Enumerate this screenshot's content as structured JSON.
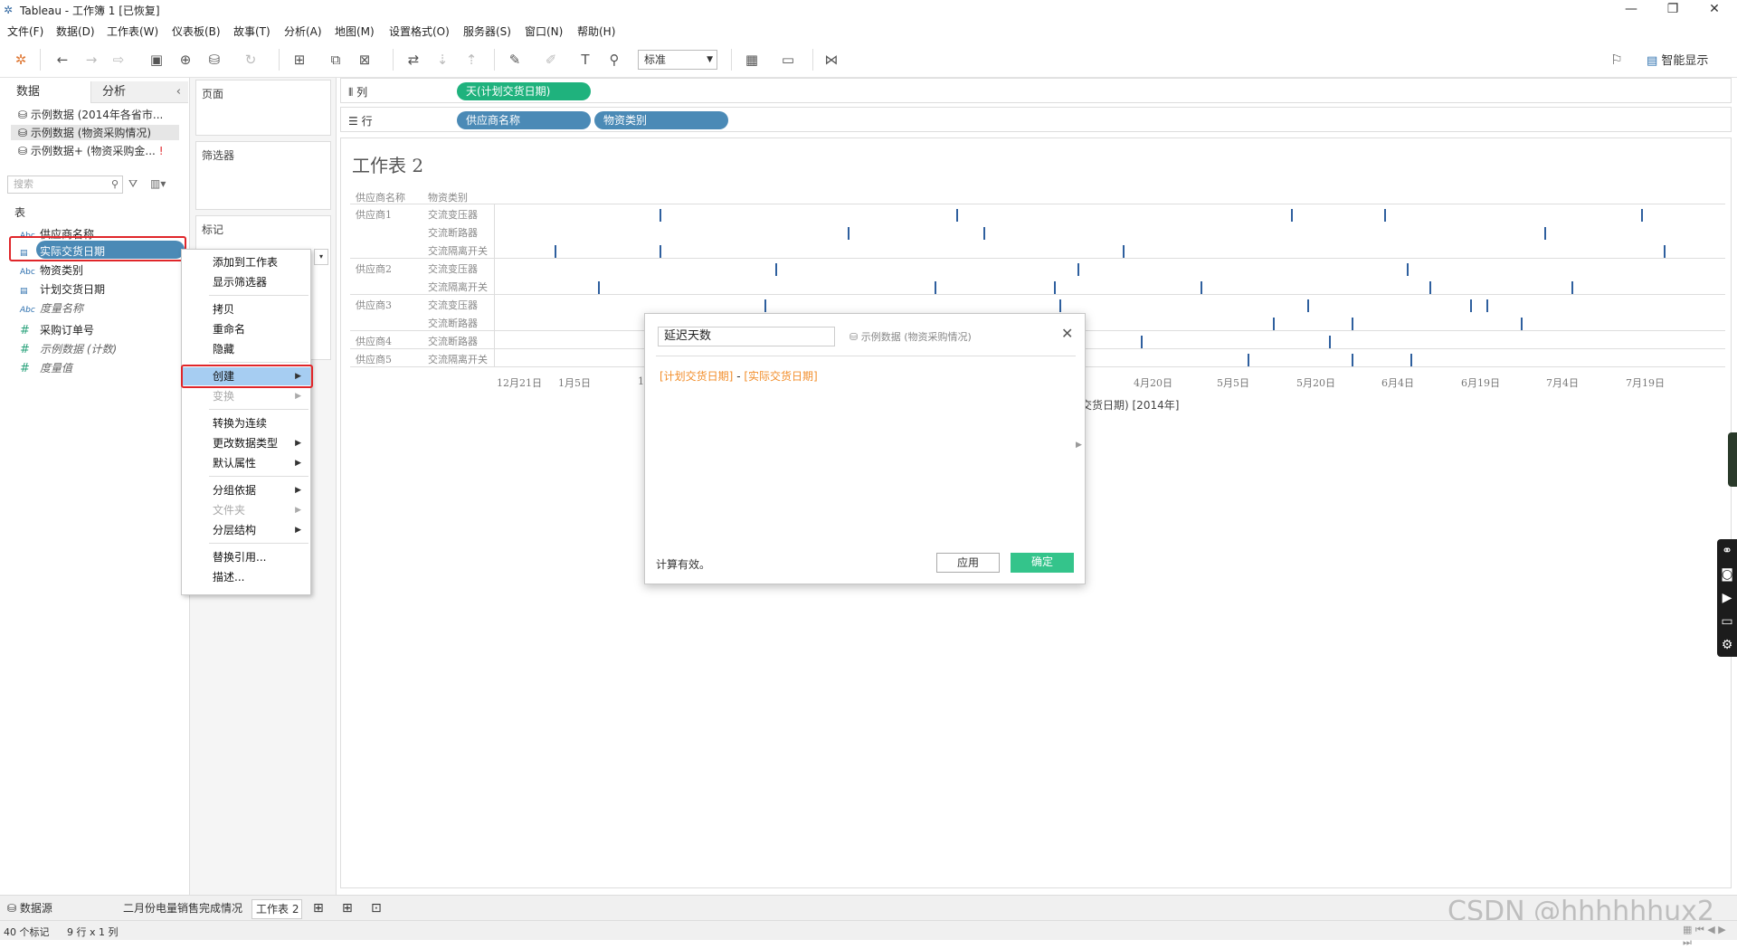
{
  "window": {
    "title": "Tableau - 工作簿 1 [已恢复]"
  },
  "menu": [
    "文件(F)",
    "数据(D)",
    "工作表(W)",
    "仪表板(B)",
    "故事(T)",
    "分析(A)",
    "地图(M)",
    "设置格式(O)",
    "服务器(S)",
    "窗口(N)",
    "帮助(H)"
  ],
  "toolbar": {
    "fit_select": "标准",
    "smart_show": "智能显示"
  },
  "left_pane": {
    "tab_data": "数据",
    "tab_analysis": "分析",
    "datasources": [
      "示例数据 (2014年各省市...",
      "示例数据 (物资采购情况)",
      "示例数据+ (物资采购金..."
    ],
    "search_placeholder": "搜索",
    "section_table": "表",
    "dimensions": [
      "供应商名称",
      "实际交货日期",
      "物资类别",
      "计划交货日期",
      "度量名称"
    ],
    "measures": [
      "采购订单号",
      "示例数据 (计数)",
      "度量值"
    ]
  },
  "cards": {
    "pages": "页面",
    "filters": "筛选器",
    "marks": "标记"
  },
  "shelves": {
    "columns_label": "列",
    "rows_label": "行",
    "columns_pills": [
      "天(计划交货日期)"
    ],
    "rows_pills": [
      "供应商名称",
      "物资类别"
    ]
  },
  "viz": {
    "title": "工作表 2",
    "header_supplier": "供应商名称",
    "header_category": "物资类别",
    "suppliers": [
      "供应商1",
      "供应商2",
      "供应商3",
      "供应商4",
      "供应商5"
    ],
    "categories": [
      "交流变压器",
      "交流断路器",
      "交流隔离开关",
      "交流变压器",
      "交流隔离开关",
      "交流变压器",
      "交流断路器",
      "交流断路器",
      "交流隔离开关"
    ],
    "axis_ticks": [
      "12月21日",
      "1月5日",
      "1",
      "4月20日",
      "5月5日",
      "5月20日",
      "6月4日",
      "6月19日",
      "7月4日",
      "7月19日"
    ],
    "axis_title": "交货日期) [2014年]"
  },
  "context_menu": {
    "items": [
      "添加到工作表",
      "显示筛选器",
      "拷贝",
      "重命名",
      "隐藏",
      "创建",
      "变换",
      "转换为连续",
      "更改数据类型",
      "默认属性",
      "分组依据",
      "文件夹",
      "分层结构",
      "替换引用...",
      "描述..."
    ]
  },
  "calc_dialog": {
    "name": "延迟天数",
    "datasource": "示例数据 (物资采购情况)",
    "formula_a": "[计划交货日期]",
    "formula_op": " - ",
    "formula_b": "[实际交货日期]",
    "status": "计算有效。",
    "apply": "应用",
    "ok": "确定"
  },
  "tabs": {
    "datasource": "数据源",
    "sheet1": "二月份电量销售完成情况",
    "sheet2": "工作表 2"
  },
  "status": {
    "marks": "40 个标记",
    "rows_cols": "9 行 x 1 列"
  },
  "watermark": "CSDN @hhhhhhux2",
  "colors": {
    "pill_green": "#1fb27d",
    "pill_blue": "#4b8ab6",
    "accent_red": "#e0262a",
    "ok_green": "#34c48b",
    "tick_blue": "#2e5f9e"
  }
}
